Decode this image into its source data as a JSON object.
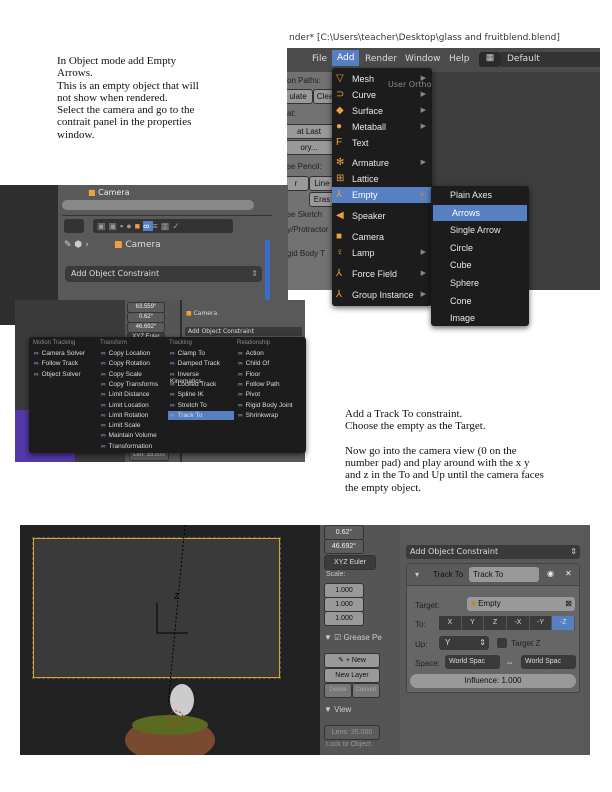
{
  "instructions_1": "In Object mode add Empty\nArrows.\nThis is an empty object that will\nnot show when rendered.\nSelect the camera and go to the\ncontrait panel in the properties\nwindow.",
  "instructions_2": "Add a Track To constraint.\nChoose the empty as the Target.\n\nNow go into the camera view (0 on the\nnumber pad) and play around with the x y\nand z in the To and Up until the camera faces\nthe empty object.",
  "shot_add_menu": {
    "title_bar": "nder* [C:\\Users\\teacher\\Desktop\\glass and fruitblend.blend]",
    "menubar": [
      "File",
      "Add",
      "Render",
      "Window",
      "Help"
    ],
    "active_menu": "Add",
    "layout": "Default",
    "viewport_label": "User Ortho",
    "left_panel": [
      "on Paths:",
      "ulate",
      "Clea",
      "at:",
      "at Last",
      "ory...",
      "se Pencil:",
      "r",
      "Line",
      "Eras",
      "se Sketch",
      "y/Protractor",
      "gid Body T"
    ],
    "add_menu": [
      {
        "label": "Mesh",
        "icon": "mesh-icon",
        "sub": true
      },
      {
        "label": "Curve",
        "icon": "curve-icon",
        "sub": true
      },
      {
        "label": "Surface",
        "icon": "surface-icon",
        "sub": true
      },
      {
        "label": "Metaball",
        "icon": "metaball-icon",
        "sub": true
      },
      {
        "label": "Text",
        "icon": "text-icon",
        "sub": false
      },
      {
        "label": "Armature",
        "icon": "armature-icon",
        "sub": true
      },
      {
        "label": "Lattice",
        "icon": "lattice-icon",
        "sub": false
      },
      {
        "label": "Empty",
        "icon": "empty-icon",
        "sub": true,
        "selected": true
      },
      {
        "label": "Speaker",
        "icon": "speaker-icon",
        "sub": false
      },
      {
        "label": "Camera",
        "icon": "camera-icon",
        "sub": false
      },
      {
        "label": "Lamp",
        "icon": "lamp-icon",
        "sub": true
      },
      {
        "label": "Force Field",
        "icon": "force-field-icon",
        "sub": true
      },
      {
        "label": "Group Instance",
        "icon": "group-instance-icon",
        "sub": true
      }
    ],
    "empty_submenu": [
      "Plain Axes",
      "Arrows",
      "Single Arrow",
      "Circle",
      "Cube",
      "Sphere",
      "Cone",
      "Image"
    ],
    "empty_selected": "Arrows"
  },
  "shot_properties": {
    "header_object": "Camera",
    "breadcrumb_object": "Camera",
    "add_constraint": "Add Object Constraint"
  },
  "shot_constraint_menu": {
    "bg_values": [
      "63.559°",
      "0.62°",
      "46.692°",
      "XYZ Euler",
      "Len: 35.000"
    ],
    "bg_object": "Camera",
    "bg_add": "Add Object Constraint",
    "columns": [
      {
        "header": "Motion Tracking",
        "items": [
          "Camera Solver",
          "Follow Track",
          "Object Solver"
        ]
      },
      {
        "header": "Transform",
        "items": [
          "Copy Location",
          "Copy Rotation",
          "Copy Scale",
          "Copy Transforms",
          "Limit Distance",
          "Limit Location",
          "Limit Rotation",
          "Limit Scale",
          "Maintain Volume",
          "Transformation"
        ]
      },
      {
        "header": "Tracking",
        "items": [
          "Clamp To",
          "Damped Track",
          "Inverse Kinematics",
          "Locked Track",
          "Spline IK",
          "Stretch To",
          "Track To"
        ]
      },
      {
        "header": "Relationship",
        "items": [
          "Action",
          "Child Of",
          "Floor",
          "Follow Path",
          "Pivot",
          "Rigid Body Joint",
          "Shrinkwrap"
        ]
      }
    ],
    "selected": "Track To"
  },
  "shot_track_to": {
    "axis_label": "Z",
    "left": {
      "values": [
        "0.62°",
        "46.692°"
      ],
      "rotation_mode": "XYZ Euler",
      "scale_label": "Scale:",
      "scale": [
        "1.000",
        "1.000",
        "1.000"
      ],
      "grease_pencil": "Grease Pe",
      "new": "New",
      "new_layer": "New Layer",
      "delete": "Delete",
      "convert": "Convert",
      "view": "View",
      "lens": "Lens: 35.000",
      "lock": "Lock to Object:"
    },
    "add_constraint": "Add Object Constraint",
    "constraint_type": "Track To",
    "constraint_name": "Track To",
    "target_label": "Target:",
    "target": "Empty",
    "to_label": "To:",
    "to_axes": [
      "X",
      "Y",
      "Z",
      "-X",
      "-Y",
      "-Z"
    ],
    "to_selected": "-Z",
    "up_label": "Up:",
    "up": "Y",
    "target_z": "Target Z",
    "target_z_checked": false,
    "space_label": "Space:",
    "owner_space": "World Spac",
    "target_space": "World Spac",
    "influence": "Influence: 1.000",
    "accent": "#5680c2"
  }
}
